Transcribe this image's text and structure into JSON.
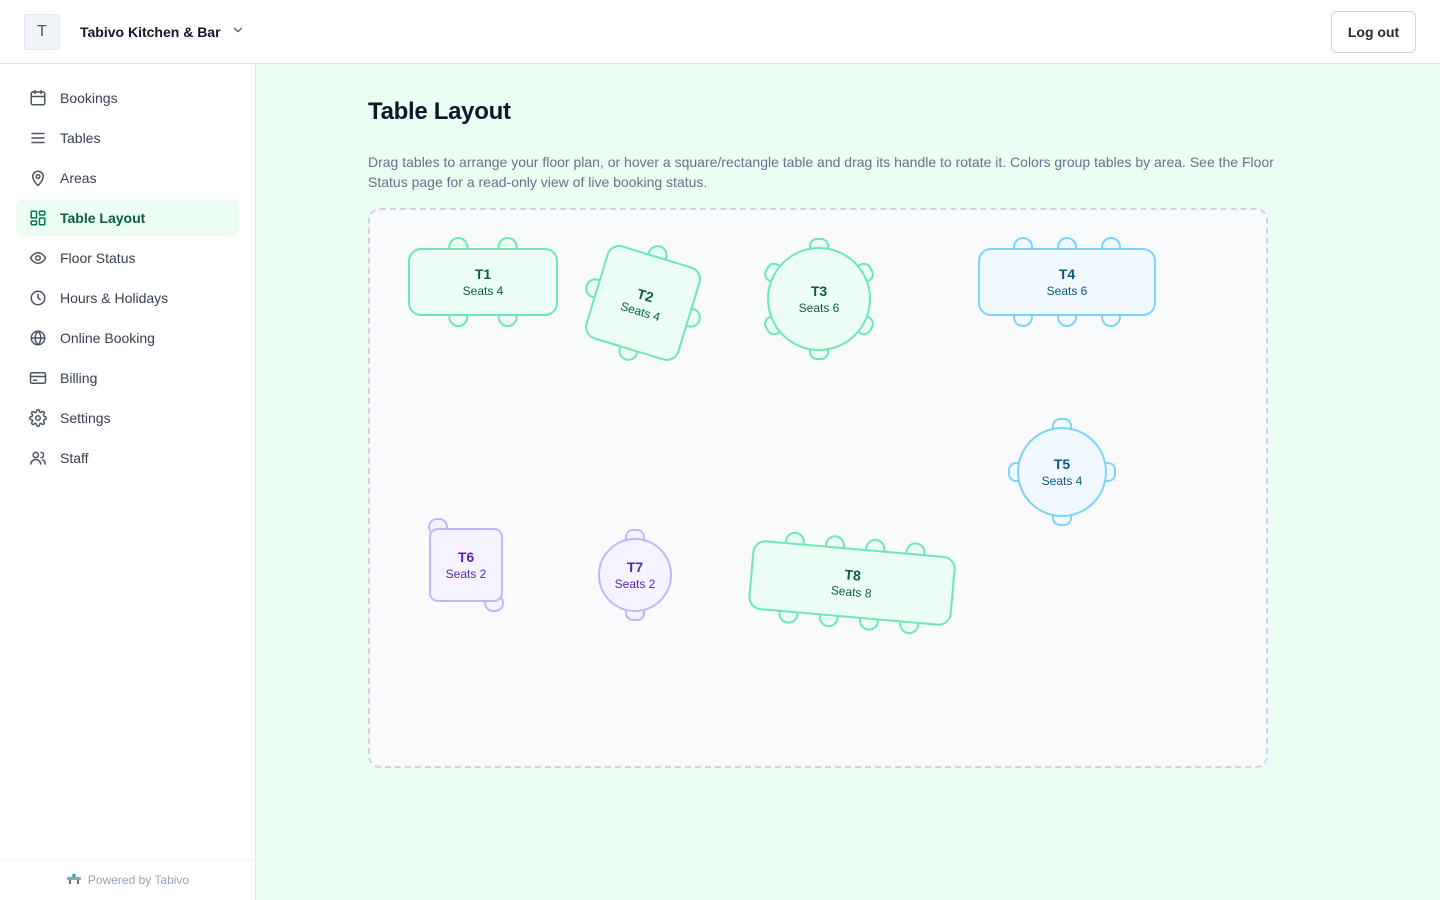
{
  "header": {
    "logo_letter": "T",
    "org_name": "Tabivo Kitchen & Bar",
    "logout_label": "Log out"
  },
  "sidebar": {
    "items": [
      {
        "label": "Bookings",
        "icon": "calendar-icon"
      },
      {
        "label": "Tables",
        "icon": "list-icon"
      },
      {
        "label": "Areas",
        "icon": "map-pin-icon"
      },
      {
        "label": "Table Layout",
        "icon": "layout-grid-icon",
        "active": true
      },
      {
        "label": "Floor Status",
        "icon": "eye-icon"
      },
      {
        "label": "Hours & Holidays",
        "icon": "clock-icon"
      },
      {
        "label": "Online Booking",
        "icon": "globe-icon"
      },
      {
        "label": "Billing",
        "icon": "credit-card-icon"
      },
      {
        "label": "Settings",
        "icon": "gear-icon"
      },
      {
        "label": "Staff",
        "icon": "users-icon"
      }
    ],
    "powered_by": "Powered by Tabivo"
  },
  "main": {
    "title": "Table Layout",
    "description": "Drag tables to arrange your floor plan, or hover a square/rectangle table and drag its handle to rotate it. Colors group tables by area. See the Floor Status page for a read-only view of live booking status."
  },
  "colors": {
    "accent": "#047857",
    "area_green": {
      "stroke": "#6ee7b7",
      "fill": "#ecfdf5",
      "text": "#065f46"
    },
    "area_blue": {
      "stroke": "#7dd3fc",
      "fill": "#f0f9ff",
      "text": "#075985"
    },
    "area_purple": {
      "stroke": "#c4b5fd",
      "fill": "#f5f3ff",
      "text": "#5b21b6"
    }
  },
  "tables": [
    {
      "name": "T1",
      "seats_label": "Seats 4",
      "shape": "rect",
      "area": "area_green",
      "rotation": 0
    },
    {
      "name": "T2",
      "seats_label": "Seats 4",
      "shape": "square",
      "area": "area_green",
      "rotation": 17
    },
    {
      "name": "T3",
      "seats_label": "Seats 6",
      "shape": "round",
      "area": "area_green",
      "rotation": 0
    },
    {
      "name": "T4",
      "seats_label": "Seats 6",
      "shape": "rect",
      "area": "area_blue",
      "rotation": 0
    },
    {
      "name": "T5",
      "seats_label": "Seats 4",
      "shape": "round",
      "area": "area_blue",
      "rotation": 0
    },
    {
      "name": "T6",
      "seats_label": "Seats 2",
      "shape": "square",
      "area": "area_purple",
      "rotation": 0
    },
    {
      "name": "T7",
      "seats_label": "Seats 2",
      "shape": "round",
      "area": "area_purple",
      "rotation": 0
    },
    {
      "name": "T8",
      "seats_label": "Seats 8",
      "shape": "rect",
      "area": "area_green",
      "rotation": 5
    }
  ]
}
